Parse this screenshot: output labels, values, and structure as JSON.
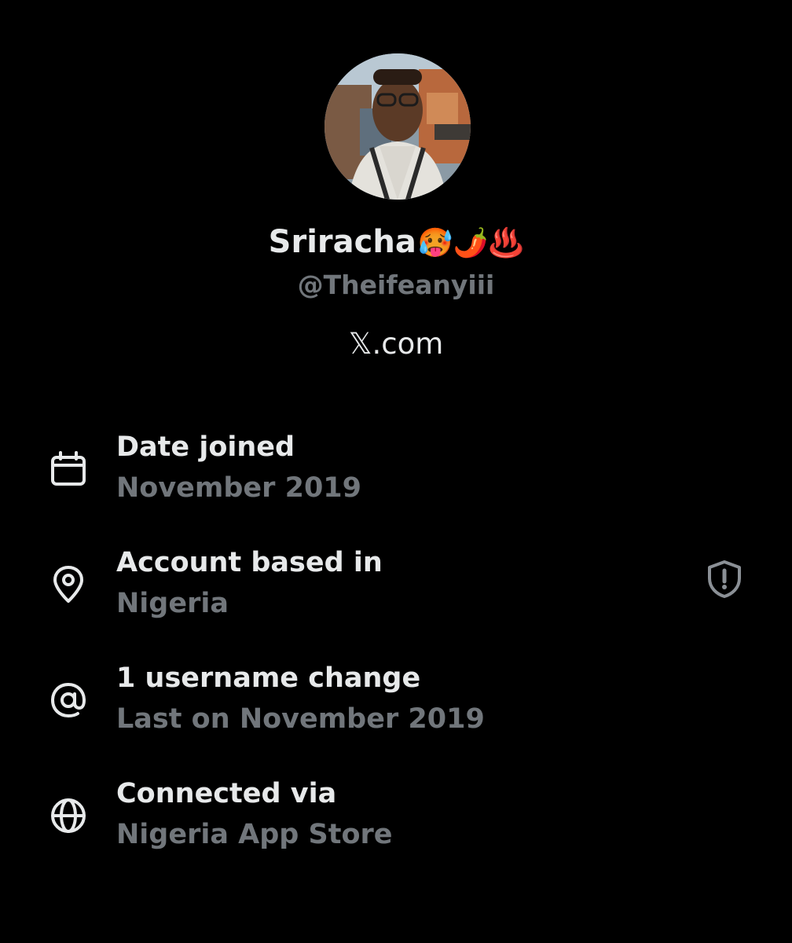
{
  "profile": {
    "display_name": "Sriracha",
    "display_name_emojis": "🥵🌶️♨️",
    "handle": "@Theifeanyiii",
    "website": "𝕏.com"
  },
  "rows": [
    {
      "icon": "calendar-icon",
      "title": "Date joined",
      "value": "November 2019"
    },
    {
      "icon": "location-pin-icon",
      "title": "Account based in",
      "value": "Nigeria",
      "badge": "shield-alert-icon"
    },
    {
      "icon": "at-sign-icon",
      "title": "1 username change",
      "value": "Last on November 2019"
    },
    {
      "icon": "globe-icon",
      "title": "Connected via",
      "value": "Nigeria App Store"
    }
  ],
  "colors": {
    "background": "#000000",
    "primary_text": "#e7e9ea",
    "secondary_text": "#71767b"
  }
}
